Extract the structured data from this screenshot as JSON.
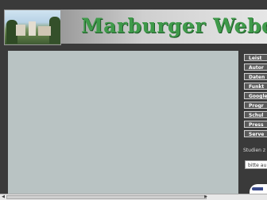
{
  "header": {
    "title": "Marburger Webd",
    "photo_alt": "Marburg town view"
  },
  "sidebar": {
    "items": [
      {
        "label": "Leist"
      },
      {
        "label": "Autor"
      },
      {
        "label": "Daten"
      },
      {
        "label": "Funkt"
      },
      {
        "label": "Google"
      },
      {
        "label": "Progr"
      },
      {
        "label": "Schul"
      },
      {
        "label": "Press"
      },
      {
        "label": "Serve"
      }
    ],
    "studies_label": "Studien z",
    "select_value": "bitte au"
  },
  "colors": {
    "background": "#3a3a3a",
    "content_panel": "#b9c3c3",
    "title_green": "#3f9a4a",
    "nav_button": "#5a5a5a"
  }
}
